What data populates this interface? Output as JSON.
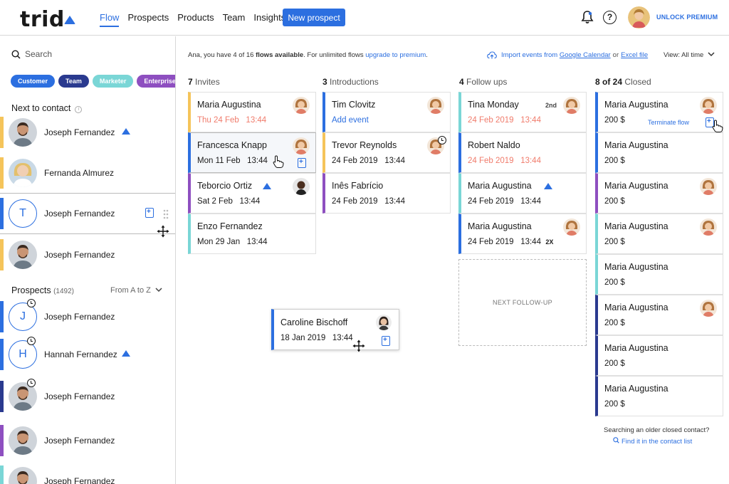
{
  "header": {
    "logo": "trid",
    "nav": [
      "Flow",
      "Prospects",
      "Products",
      "Team",
      "Insights"
    ],
    "active_nav": "Flow",
    "new_prospect": "New prospect",
    "unlock": "UNLOCK PREMIUM"
  },
  "sidebar": {
    "search_placeholder": "Search",
    "tags": [
      {
        "label": "Customer",
        "color": "#2c6fe0"
      },
      {
        "label": "Team",
        "color": "#2a3a8f"
      },
      {
        "label": "Marketer",
        "color": "#7ad6d6"
      },
      {
        "label": "Enterprise",
        "color": "#8e4fc0"
      }
    ],
    "next_title": "Next to contact",
    "next_contacts": [
      {
        "name": "Joseph Fernandez",
        "bar": "#f5c45a"
      },
      {
        "name": "Fernanda Almurez",
        "bar": "#f5c45a"
      },
      {
        "name": "Joseph Fernandez",
        "initial": "T",
        "bar": "#2c6fe0"
      },
      {
        "name": "Joseph Fernandez",
        "bar": "#f5c45a"
      }
    ],
    "prospects_title": "Prospects",
    "prospects_count": "(1492)",
    "sort": "From A to Z",
    "prospects": [
      {
        "name": "Joseph Fernandez",
        "initial": "J",
        "bar": "#2c6fe0"
      },
      {
        "name": "Hannah Fernandez",
        "initial": "H",
        "bar": "#2c6fe0"
      },
      {
        "name": "Joseph Fernandez",
        "bar": "#2a3a8f"
      },
      {
        "name": "Joseph Fernandez",
        "bar": "#8e4fc0"
      },
      {
        "name": "Joseph Fernandez",
        "bar": "#7ad6d6"
      }
    ]
  },
  "main": {
    "info_prefix": "Ana, you have 4 of 16 ",
    "info_bold": "flows available",
    "info_mid": ". For unlimited flows ",
    "info_link": "upgrade to premium",
    "info_end": ".",
    "import_text": "Import events from",
    "import_gcal": "Google Calendar",
    "import_or": "or",
    "import_excel": "Excel file",
    "view_all": "View: All time",
    "columns": [
      {
        "count": "7",
        "label": "Invites"
      },
      {
        "count": "3",
        "label": "Introductions"
      },
      {
        "count": "4",
        "label": "Follow ups"
      },
      {
        "count": "8 of 24",
        "label": "Closed"
      }
    ],
    "invites": [
      {
        "name": "Maria Augustina",
        "date": "Thu 24 Feb",
        "time": "13:44",
        "bar": "#f5c45a"
      },
      {
        "name": "Francesca Knapp",
        "date": "Mon 11 Feb",
        "time": "13:44",
        "bar": "#2c6fe0"
      },
      {
        "name": "Teborcio Ortiz",
        "date": "Sat 2 Feb",
        "time": "13:44",
        "bar": "#8e4fc0"
      },
      {
        "name": "Enzo Fernandez",
        "date": "Mon 29 Jan",
        "time": "13:44",
        "bar": "#7ad6d6"
      }
    ],
    "introductions": [
      {
        "name": "Tim Clovitz",
        "action": "Add event",
        "bar": "#2c6fe0"
      },
      {
        "name": "Trevor Reynolds",
        "date": "24 Feb 2019",
        "time": "13:44",
        "bar": "#f5c45a"
      },
      {
        "name": "Inês Fabrício",
        "date": "24 Feb 2019",
        "time": "13:44",
        "bar": "#8e4fc0"
      }
    ],
    "followups": [
      {
        "name": "Tina Monday",
        "date": "24 Feb 2019",
        "time": "13:44",
        "badge": "2nd",
        "bar": "#7ad6d6"
      },
      {
        "name": "Robert Naldo",
        "date": "24 Feb 2019",
        "time": "13:44",
        "bar": "#2c6fe0"
      },
      {
        "name": "Maria Augustina",
        "date": "24 Feb 2019",
        "time": "13:44",
        "bar": "#7ad6d6"
      },
      {
        "name": "Maria Augustina",
        "date": "24 Feb 2019",
        "time": "13:44",
        "badge": "2X",
        "bar": "#2c6fe0"
      }
    ],
    "next_followup": "NEXT FOLLOW-UP",
    "closed": [
      {
        "name": "Maria Augustina",
        "amount": "200 $",
        "bar": "#2c6fe0"
      },
      {
        "name": "Maria Augustina",
        "amount": "200 $",
        "bar": "#2c6fe0"
      },
      {
        "name": "Maria Augustina",
        "amount": "200 $",
        "bar": "#8e4fc0"
      },
      {
        "name": "Maria Augustina",
        "amount": "200 $",
        "bar": "#7ad6d6"
      },
      {
        "name": "Maria Augustina",
        "amount": "200 $",
        "bar": "#7ad6d6"
      },
      {
        "name": "Maria Augustina",
        "amount": "200 $",
        "bar": "#2a3a8f"
      },
      {
        "name": "Maria Augustina",
        "amount": "200 $",
        "bar": "#2a3a8f"
      },
      {
        "name": "Maria Augustina",
        "amount": "200 $",
        "bar": "#2a3a8f"
      }
    ],
    "terminate": "Terminate flow",
    "dragging": {
      "name": "Caroline Bischoff",
      "date": "18 Jan 2019",
      "time": "13:44"
    },
    "older_text": "Searching an older closed contact?",
    "find_link": "Find it in the contact list"
  }
}
